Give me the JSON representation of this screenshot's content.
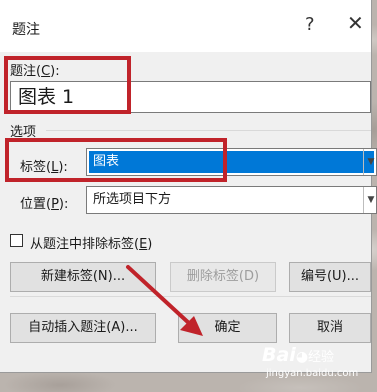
{
  "dialog": {
    "title": "题注",
    "help_glyph": "?",
    "close_glyph": "✕",
    "caption_label_text": "题注(",
    "caption_label_key": "C",
    "caption_label_end": "):",
    "caption_value": "图表 1",
    "options_header": "选项",
    "label_field_text": "标签(",
    "label_field_key": "L",
    "label_field_end": "):",
    "label_value": "图表",
    "position_field_text": "位置(",
    "position_field_key": "P",
    "position_field_end": "):",
    "position_value": "所选项目下方",
    "exclude_label_text": "从题注中排除标签(",
    "exclude_label_key": "E",
    "exclude_label_end": ")",
    "exclude_checked": false,
    "new_label_button": "新建标签(N)...",
    "delete_label_button": "删除标签(D)",
    "numbering_button": "编号(U)...",
    "autocaption_button": "自动插入题注(A)...",
    "ok_button": "确定",
    "cancel_button": "取消"
  },
  "colors": {
    "highlight": "#c0232a",
    "selection": "#0078d7"
  },
  "watermark": {
    "logo": "Bai",
    "logo_end": "经验",
    "url": "jingyan.baidu.com"
  }
}
